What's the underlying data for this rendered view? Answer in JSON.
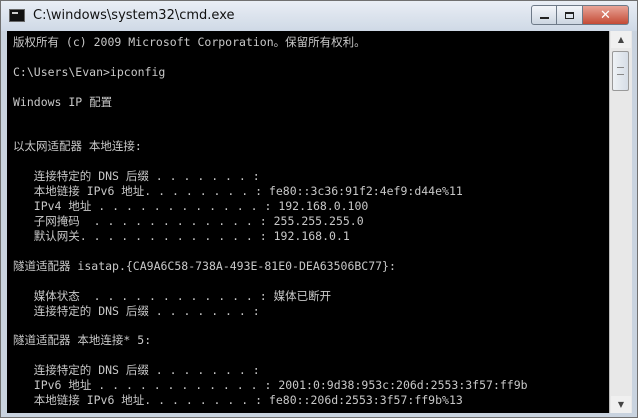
{
  "window": {
    "title": "C:\\windows\\system32\\cmd.exe",
    "close_glyph": "✕"
  },
  "console": {
    "lines": [
      "版权所有 (c) 2009 Microsoft Corporation。保留所有权利。",
      "C:\\Users\\Evan>ipconfig",
      "Windows IP 配置",
      "以太网适配器 本地连接:",
      "   连接特定的 DNS 后缀 . . . . . . . :",
      "   本地链接 IPv6 地址. . . . . . . . : fe80::3c36:91f2:4ef9:d44e%11",
      "   IPv4 地址 . . . . . . . . . . . . : 192.168.0.100",
      "   子网掩码  . . . . . . . . . . . . : 255.255.255.0",
      "   默认网关. . . . . . . . . . . . . : 192.168.0.1",
      "隧道适配器 isatap.{CA9A6C58-738A-493E-81E0-DEA63506BC77}:",
      "   媒体状态  . . . . . . . . . . . . : 媒体已断开",
      "   连接特定的 DNS 后缀 . . . . . . . :",
      "隧道适配器 本地连接* 5:",
      "   连接特定的 DNS 后缀 . . . . . . . :",
      "   IPv6 地址 . . . . . . . . . . . . : 2001:0:9d38:953c:206d:2553:3f57:ff9b",
      "   本地链接 IPv6 地址. . . . . . . . : fe80::206d:2553:3f57:ff9b%13"
    ]
  }
}
